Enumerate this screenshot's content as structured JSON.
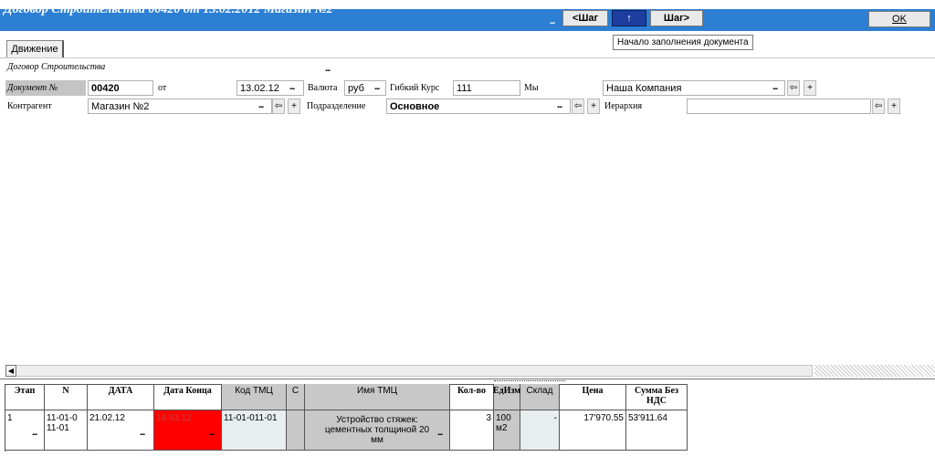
{
  "window": {
    "title": "Договор Строительства 00420 от 13.02.2012 Магазин №2",
    "ellipsis": "...",
    "step_back_label": "<Шаг",
    "up_label": "↑",
    "step_forward_label": "Шаг>",
    "ok_label": "OK",
    "tooltip": "Начало заполнения документа"
  },
  "tabs": [
    {
      "label": "Движение"
    }
  ],
  "form": {
    "doc_type_label": "Договор Строительства",
    "doc_number_label": "Документ №",
    "doc_number": "00420",
    "from_label": "от",
    "date": "13.02.12",
    "currency_label": "Валюта",
    "currency": "руб",
    "rate_label": "Гибкий Курс",
    "rate": "111",
    "we_label": "Мы",
    "company": "Наша Компания",
    "counterparty_label": "Контрагент",
    "counterparty": "Магазин №2",
    "department_label": "Подразделение",
    "department": "Основное",
    "hierarchy_label": "Иерархия",
    "hierarchy": "",
    "back_icon": "⇦",
    "plus_icon": "+"
  },
  "grid": {
    "columns": {
      "stage": "Этап",
      "n": "N",
      "date": "ДАТА",
      "end_date": "Дата Конца",
      "code": "Код ТМЦ",
      "c": "С",
      "name": "Имя ТМЦ",
      "qty": "Кол-во",
      "unit": "ЕдИзм",
      "warehouse": "Склад",
      "price": "Цена",
      "sum": "Сумма Без НДС"
    },
    "rows": [
      {
        "stage": "1",
        "n_line1": "11-01-0",
        "n_line2": "11-01",
        "date": "21.02.12",
        "end_date": "14.03.12",
        "code": "11-01-011-01",
        "c": "",
        "name": "Устройство стяжек: цементных толщиной 20 мм",
        "qty": "3",
        "unit": "100 м2",
        "warehouse": "-",
        "price": "17'970.55",
        "sum": "53'911.64"
      }
    ]
  },
  "colors": {
    "title_bar": "#2c7fd3",
    "up_button": "#1d3e9e",
    "end_date_highlight": "#ff0000",
    "grid_header_gray": "#c8c8c8"
  },
  "icons": {
    "back": "back-arrow-icon",
    "add": "plus-icon",
    "scroll_left": "scroll-left-arrow-icon",
    "ellipsis": "ellipsis-icon"
  }
}
